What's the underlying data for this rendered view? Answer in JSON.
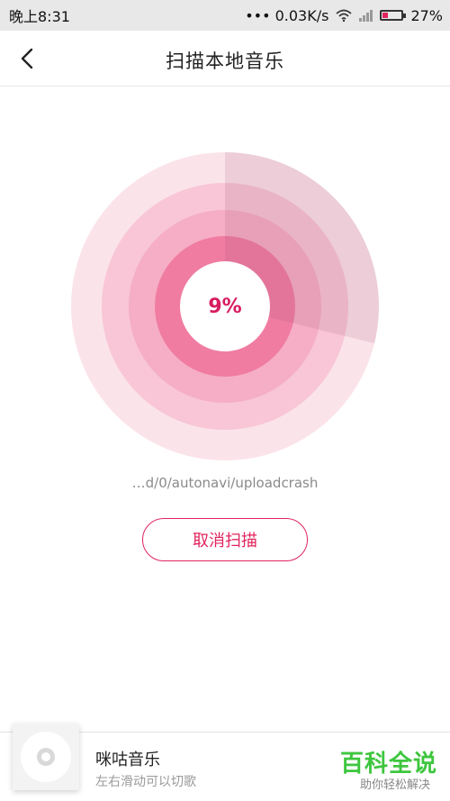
{
  "status_bar": {
    "time": "晚上8:31",
    "speed": "••• 0.03K/s",
    "battery": "27%",
    "battery_level": 0.27
  },
  "header": {
    "title": "扫描本地音乐"
  },
  "scan": {
    "progress": "9%",
    "current_path": "…d/0/autonavi/uploadcrash",
    "cancel_label": "取消扫描",
    "accent_color": "#e0245e"
  },
  "player": {
    "title": "咪咕音乐",
    "hint": "左右滑动可以切歌"
  },
  "watermark": {
    "title": "百科全说",
    "subtitle": "助你轻松解决"
  }
}
